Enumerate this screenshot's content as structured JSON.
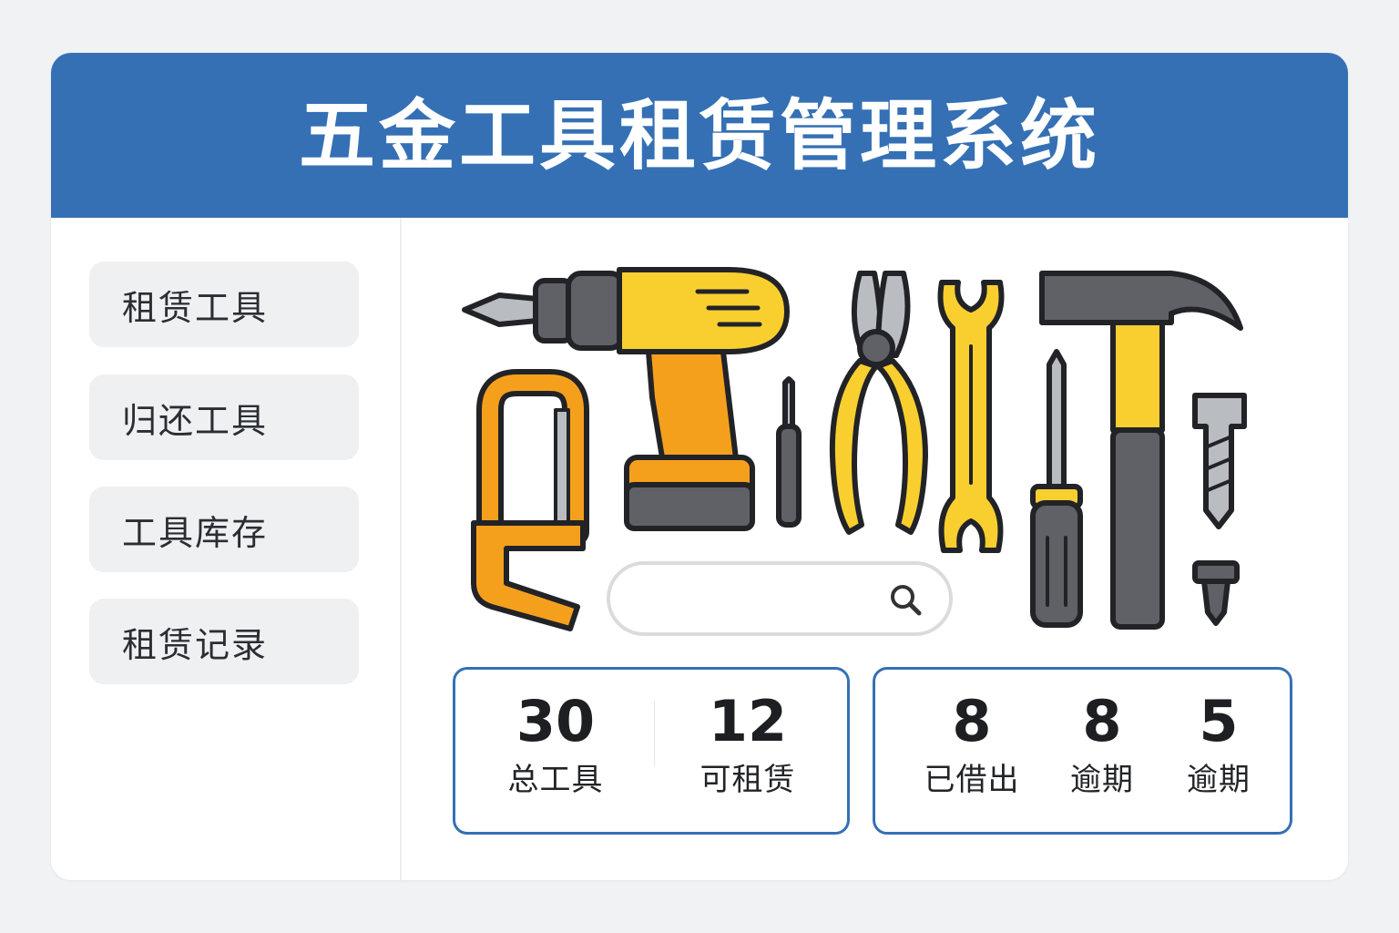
{
  "app": {
    "title": "五金工具租赁管理系统"
  },
  "colors": {
    "header": "#3570b5",
    "accent_yellow": "#f9cf30",
    "accent_orange": "#f5a01d",
    "tool_gray": "#5f6166"
  },
  "sidebar": {
    "items": [
      {
        "label": "租赁工具"
      },
      {
        "label": "归还工具"
      },
      {
        "label": "工具库存"
      },
      {
        "label": "租赁记录"
      }
    ]
  },
  "search": {
    "placeholder": "",
    "value": "",
    "icon": "search-icon"
  },
  "illustration": {
    "icons": [
      "drill-icon",
      "hacksaw-icon",
      "small-screwdriver-icon",
      "pliers-icon",
      "wrench-icon",
      "screwdriver-icon",
      "hammer-icon",
      "bolt-icon",
      "screw-icon"
    ]
  },
  "stats": {
    "box1": [
      {
        "value": "30",
        "label": "总工具"
      },
      {
        "value": "12",
        "label": "可租赁"
      }
    ],
    "box2": [
      {
        "value": "8",
        "label": "已借出"
      },
      {
        "value": "8",
        "label": "逾期"
      },
      {
        "value": "5",
        "label": "逾期"
      }
    ]
  }
}
